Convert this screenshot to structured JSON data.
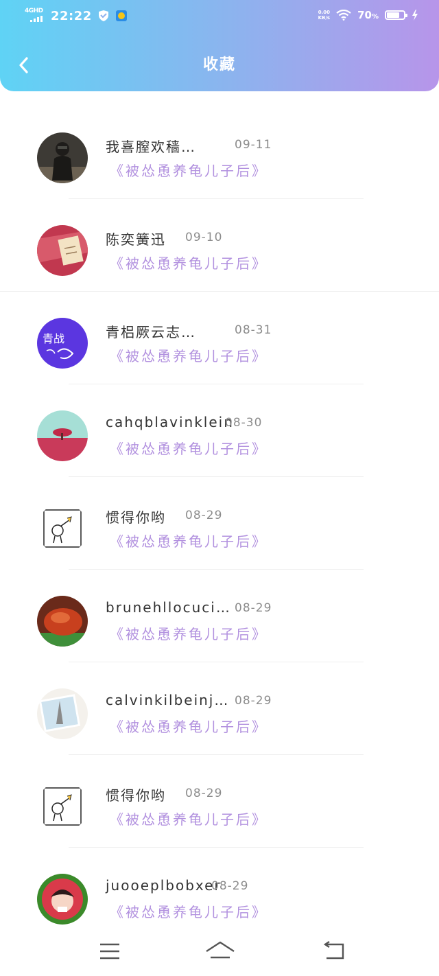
{
  "status_bar": {
    "network": "4GHD",
    "time": "22:22",
    "speed_value": "0.00",
    "speed_unit": "KB/s",
    "battery": "70"
  },
  "header": {
    "title": "收藏",
    "back_icon": "chevron-left-icon"
  },
  "items": [
    {
      "name": "我喜膣欢穑…",
      "date": "09-11",
      "book": "《被怂恿养龟儿子后》"
    },
    {
      "name": "陈奕簧迅",
      "date": "09-10",
      "book": "《被怂恿养龟儿子后》"
    },
    {
      "name": "青梠厥云志…",
      "date": "08-31",
      "book": "《被怂恿养龟儿子后》"
    },
    {
      "name": "cahqblavinklein",
      "date": "08-30",
      "book": "《被怂恿养龟儿子后》"
    },
    {
      "name": "惯得你哟",
      "date": "08-29",
      "book": "《被怂恿养龟儿子后》"
    },
    {
      "name": "brunehllocuci…",
      "date": "08-29",
      "book": "《被怂恿养龟儿子后》"
    },
    {
      "name": "calvinkilbeinj…",
      "date": "08-29",
      "book": "《被怂恿养龟儿子后》"
    },
    {
      "name": "惯得你哟",
      "date": "08-29",
      "book": "《被怂恿养龟儿子后》"
    },
    {
      "name": "juooeplbobxer",
      "date": "08-29",
      "book": "《被怂恿养龟儿子后》"
    }
  ],
  "nav": {
    "menu_icon": "menu-icon",
    "home_icon": "home-icon",
    "back_icon": "back-icon"
  },
  "colors": {
    "header_gradient_start": "#5fd3f5",
    "header_gradient_end": "#b795ea",
    "book_title": "#b291df"
  }
}
